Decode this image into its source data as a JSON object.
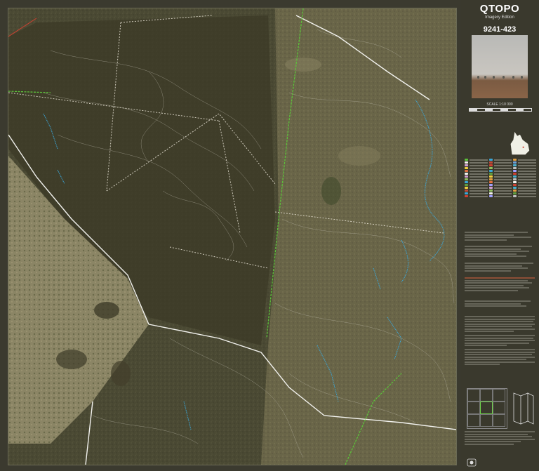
{
  "header": {
    "title": "QTOPO",
    "subtitle": "Imagery Edition",
    "sheet_number": "9241-423"
  },
  "scale": {
    "label": "SCALE 1:10 000"
  },
  "map": {
    "track_color": "#f2f2ee",
    "boundary_green": "#5cc23a",
    "water_blue": "#3aa6d8",
    "contour_color": "#c9c6b8"
  }
}
